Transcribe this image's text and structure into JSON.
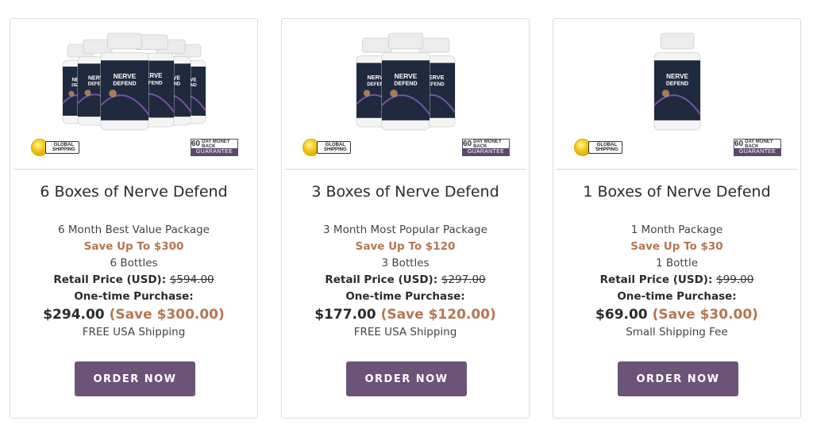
{
  "colors": {
    "accent": "#b5764f",
    "button": "#6b5478",
    "guarantee": "#5b4a6e",
    "bottle_label": "#1f2a3e"
  },
  "badges": {
    "shipping_line1": "GLOBAL",
    "shipping_line2": "SHIPPING",
    "guarantee_days": "60",
    "guarantee_top": "DAY MONEY BACK",
    "guarantee_bottom": "GUARANTEE"
  },
  "bottle": {
    "brand_line1": "NERVE",
    "brand_line2": "DEFEND"
  },
  "cards": [
    {
      "bottles_shown": 6,
      "title": "6 Boxes of Nerve Defend",
      "package": "6 Month Best Value Package",
      "save_up_to": "Save Up To $300",
      "quantity": "6 Bottles",
      "retail_label": "Retail Price (USD):",
      "retail_price": "$594.00",
      "onetime_label": "One-time Purchase:",
      "price": "$294.00",
      "save": "(Save $300.00)",
      "shipping": "FREE USA Shipping",
      "button": "ORDER NOW"
    },
    {
      "bottles_shown": 3,
      "title": "3 Boxes of Nerve Defend",
      "package": "3 Month Most Popular Package",
      "save_up_to": "Save Up To $120",
      "quantity": "3 Bottles",
      "retail_label": "Retail Price (USD):",
      "retail_price": "$297.00",
      "onetime_label": "One-time Purchase:",
      "price": "$177.00",
      "save": "(Save $120.00)",
      "shipping": "FREE USA Shipping",
      "button": "ORDER NOW"
    },
    {
      "bottles_shown": 1,
      "title": "1 Boxes of Nerve Defend",
      "package": "1 Month Package",
      "save_up_to": "Save Up To $30",
      "quantity": "1 Bottle",
      "retail_label": "Retail Price (USD):",
      "retail_price": "$99.00",
      "onetime_label": "One-time Purchase:",
      "price": "$69.00",
      "save": "(Save $30.00)",
      "shipping": "Small Shipping Fee",
      "button": "ORDER NOW"
    }
  ]
}
